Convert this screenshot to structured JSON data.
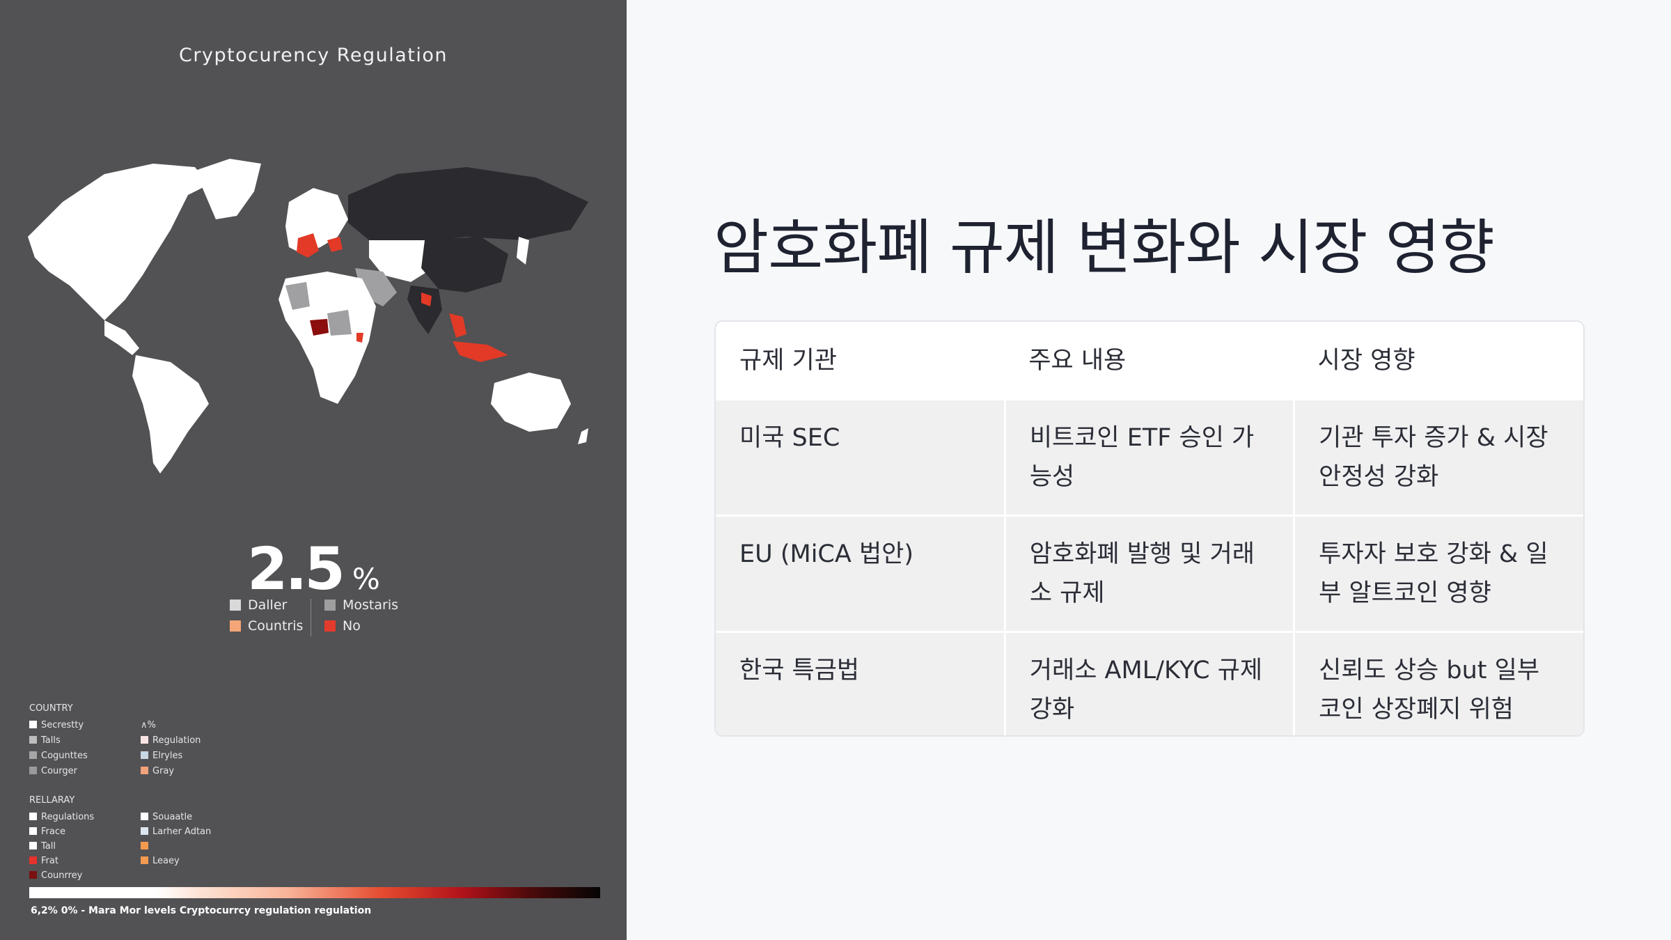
{
  "poster": {
    "title": "Cryptocurency Regulation",
    "big_value": "2.5",
    "big_unit": "%",
    "stat_legend": [
      {
        "label": "Daller",
        "color": "#d9d9d9"
      },
      {
        "label": "Mostaris",
        "color": "#9e9e9e"
      },
      {
        "label": "Countris",
        "color": "#f4a679"
      },
      {
        "label": "No",
        "color": "#e33b2e"
      }
    ],
    "legend_country_header": "COUNTRY",
    "legend_percent_header": "∧%",
    "legend_country_items": [
      {
        "label": "Secrestty",
        "color": "#ffffff"
      },
      {
        "label": "Talls",
        "color": "#bdbdbd"
      },
      {
        "label": "Cogunttes",
        "color": "#a6a6a6"
      },
      {
        "label": "Courger",
        "color": "#9a9a9a"
      }
    ],
    "legend_percent_items": [
      {
        "label": "Regulation",
        "color": "#fbe3e3"
      },
      {
        "label": "Elryles",
        "color": "#c9d6e3"
      },
      {
        "label": "Gray",
        "color": "#f2a27a"
      }
    ],
    "legend_rellaray_header": "RELLARAY",
    "legend_rellaray_items": [
      {
        "label": "Regulations",
        "color": "#ffffff"
      },
      {
        "label": "Frace",
        "color": "#ffffff"
      },
      {
        "label": "Tall",
        "color": "#ffffff"
      },
      {
        "label": "Frat",
        "color": "#e5322b"
      },
      {
        "label": "Counrrey",
        "color": "#7a1010"
      }
    ],
    "legend_right_items": [
      {
        "label": "Souaatle",
        "color": "#ffffff"
      },
      {
        "label": "Larher Adtan",
        "color": "#dbe6ee"
      },
      {
        "label": "",
        "color": "#f39a4f"
      },
      {
        "label": "Leaey",
        "color": "#f39a4f"
      }
    ],
    "footnote": "6,2% 0% - Mara Mor levels Cryptocurrcy regulation regulation",
    "colors": {
      "background": "#525154",
      "land_default": "#ffffff",
      "land_dark": "#2b2a2e",
      "land_gray": "#a0a0a3",
      "land_red": "#e23a27",
      "land_darkred": "#8b0d0d"
    }
  },
  "slide": {
    "title": "암호화폐 규제 변화와 시장 영향",
    "table": {
      "headers": [
        "규제 기관",
        "주요 내용",
        "시장 영향"
      ],
      "rows": [
        [
          "미국 SEC",
          "비트코인 ETF 승인 가능성",
          "기관 투자 증가 & 시장 안정성 강화"
        ],
        [
          "EU (MiCA 법안)",
          "암호화폐 발행 및 거래소 규제",
          "투자자 보호 강화 & 일부 알트코인 영향"
        ],
        [
          "한국 특금법",
          "거래소 AML/KYC 규제 강화",
          "신뢰도 상승 but 일부 코인 상장폐지 위험"
        ]
      ]
    }
  }
}
